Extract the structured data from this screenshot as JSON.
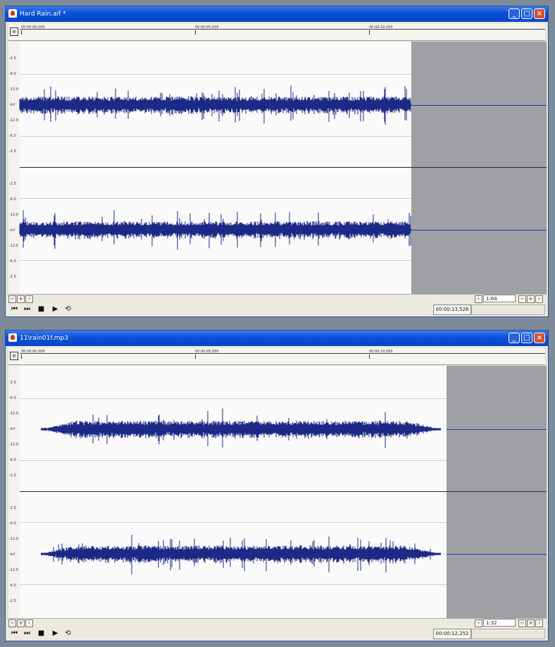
{
  "window1": {
    "title": "Hard Rain.aif *",
    "ruler_ticks": [
      "00:00:00,000",
      "00:00:05,000",
      "00:00:10,000"
    ],
    "scale_labels_top": [
      "-2.5",
      "-6.0",
      "-12.0",
      "-Inf",
      "-12.0",
      "-6.0",
      "-2.5"
    ],
    "scale_labels_bottom": [
      "-2.5",
      "-6.0",
      "-12.0",
      "-Inf",
      "-12.0",
      "-6.0",
      "-2.5"
    ],
    "zoom": "1:64",
    "timecode": "00:00:13,526"
  },
  "window2": {
    "title": "11\\rain01f.mp3",
    "ruler_ticks": [
      "00:00:00,000",
      "00:00:05,000",
      "00:00:10,000"
    ],
    "scale_labels_top": [
      "-2.5",
      "-6.0",
      "-12.0",
      "-Inf",
      "-12.0",
      "-6.0",
      "-2.5"
    ],
    "scale_labels_bottom": [
      "-2.5",
      "-6.0",
      "-12.0",
      "-Inf",
      "-12.0",
      "-6.0",
      "-2.5"
    ],
    "zoom": "1:32",
    "timecode": "00:00:12,252"
  },
  "controls": {
    "minimize": "_",
    "maximize": "□",
    "close": "×",
    "ruler_icon": "≡",
    "scroll_left": "‹",
    "scroll_right": "›",
    "zoom_in": "+",
    "zoom_out": "−",
    "go_start": "⏮",
    "go_end": "⏭",
    "stop": "■",
    "play": "▶",
    "loop": "⟲"
  },
  "colors": {
    "waveform": "#1c2a86",
    "titlebar": "#0a4fd6",
    "empty_area": "#9fa0a3"
  }
}
